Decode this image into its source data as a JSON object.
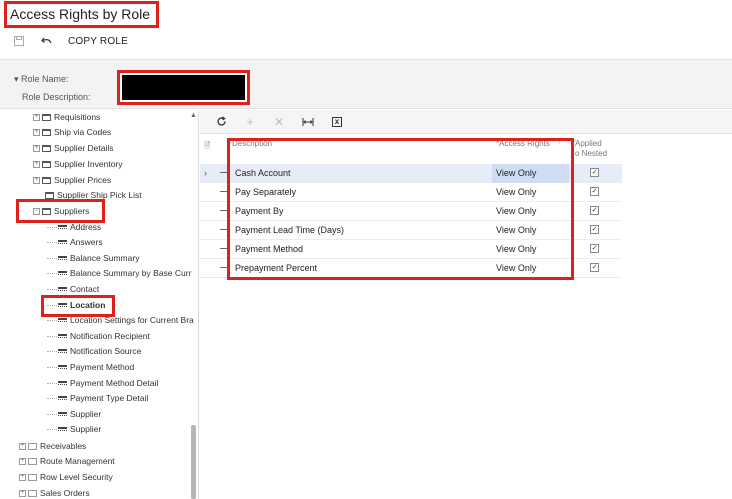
{
  "page": {
    "title": "Access Rights by Role"
  },
  "toolbar": {
    "save_icon": "save-icon",
    "undo_icon": "undo-icon",
    "copy_role_label": "COPY ROLE"
  },
  "form": {
    "role_name_label": "Role Name:",
    "role_description_label": "Role Description:"
  },
  "tree": {
    "items": [
      {
        "label": "Requisitions",
        "type": "folder"
      },
      {
        "label": "Ship via Codes",
        "type": "folder"
      },
      {
        "label": "Supplier Details",
        "type": "folder"
      },
      {
        "label": "Supplier Inventory",
        "type": "folder"
      },
      {
        "label": "Supplier Prices",
        "type": "folder"
      },
      {
        "label": "Supplier Ship Pick List",
        "type": "folder"
      },
      {
        "label": "Suppliers",
        "type": "folder",
        "expanded": true
      },
      {
        "label": "Address",
        "type": "leaf"
      },
      {
        "label": "Answers",
        "type": "leaf"
      },
      {
        "label": "Balance Summary",
        "type": "leaf"
      },
      {
        "label": "Balance Summary by Base Curr",
        "type": "leaf"
      },
      {
        "label": "Contact",
        "type": "leaf"
      },
      {
        "label": "Location",
        "type": "leaf",
        "bold": true
      },
      {
        "label": "Location Settings for Current Bra",
        "type": "leaf"
      },
      {
        "label": "Notification Recipient",
        "type": "leaf"
      },
      {
        "label": "Notification Source",
        "type": "leaf"
      },
      {
        "label": "Payment Method",
        "type": "leaf"
      },
      {
        "label": "Payment Method Detail",
        "type": "leaf"
      },
      {
        "label": "Payment Type Detail",
        "type": "leaf"
      },
      {
        "label": "Supplier",
        "type": "leaf"
      },
      {
        "label": "Supplier",
        "type": "leaf"
      },
      {
        "label": "Receivables",
        "type": "module"
      },
      {
        "label": "Route Management",
        "type": "module"
      },
      {
        "label": "Row Level Security",
        "type": "module"
      },
      {
        "label": "Sales Orders",
        "type": "module"
      }
    ]
  },
  "grid": {
    "toolbar": {
      "refresh_icon": "refresh-icon",
      "add_icon": "add-icon",
      "delete_icon": "delete-icon",
      "fit_icon": "fit-columns-icon",
      "excel_icon": "export-excel-icon"
    },
    "columns": {
      "description": "Description",
      "access_rights": "Access Rights",
      "applied_line1": "Applied",
      "applied_line2": "o Nested"
    },
    "rows": [
      {
        "description": "Cash Account",
        "access_rights": "View Only",
        "applied": true,
        "selected": true
      },
      {
        "description": "Pay Separately",
        "access_rights": "View Only",
        "applied": true
      },
      {
        "description": "Payment By",
        "access_rights": "View Only",
        "applied": true
      },
      {
        "description": "Payment Lead Time (Days)",
        "access_rights": "View Only",
        "applied": true
      },
      {
        "description": "Payment Method",
        "access_rights": "View Only",
        "applied": true
      },
      {
        "description": "Prepayment Percent",
        "access_rights": "View Only",
        "applied": true
      }
    ]
  },
  "colors": {
    "highlight": "#e0201b",
    "selected_row": "#e6edf8"
  }
}
